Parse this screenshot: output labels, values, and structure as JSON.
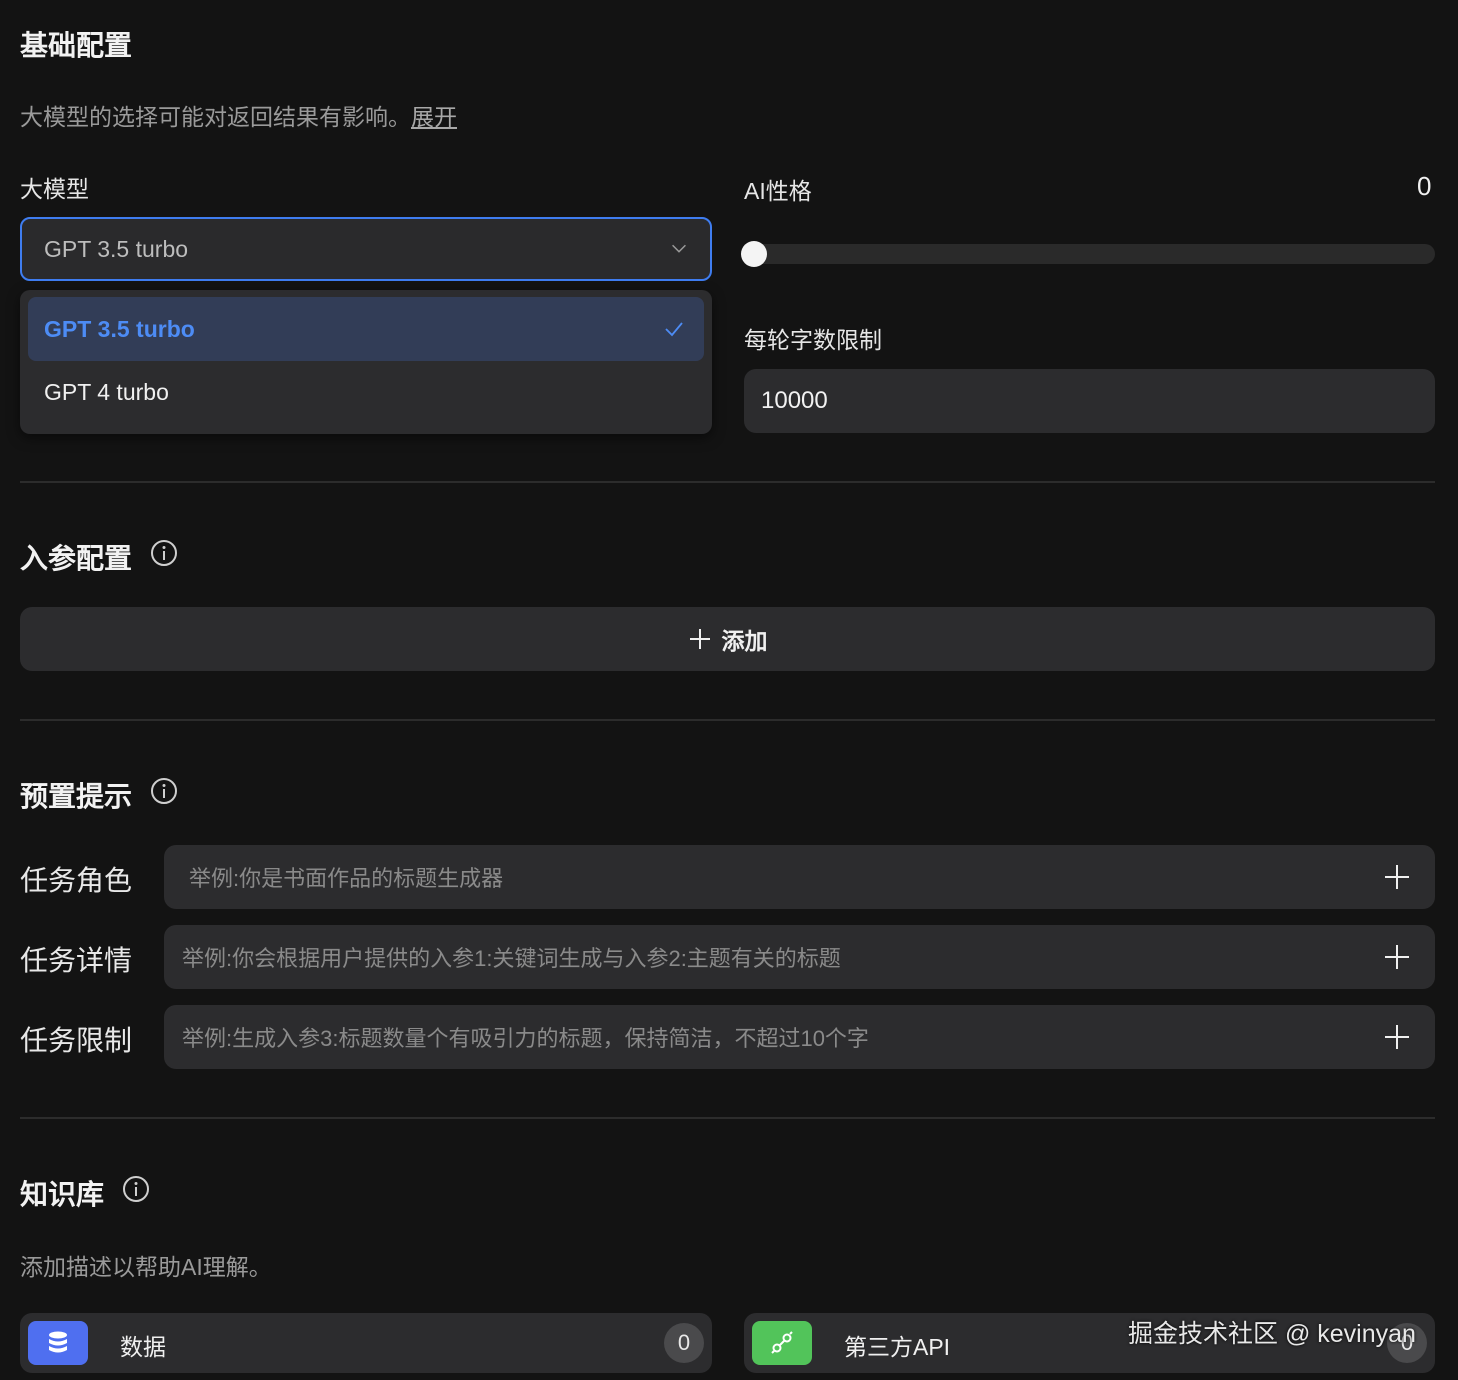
{
  "basic": {
    "title": "基础配置",
    "desc": "大模型的选择可能对返回结果有影响。",
    "expand_link": "展开",
    "model_label": "大模型",
    "model_selected": "GPT 3.5 turbo",
    "model_options": [
      "GPT 3.5 turbo",
      "GPT 4 turbo"
    ],
    "personality_label": "AI性格",
    "personality_value": "0",
    "word_limit_label": "每轮字数限制",
    "word_limit_value": "10000"
  },
  "params": {
    "title": "入参配置",
    "add_label": "添加"
  },
  "preset": {
    "title": "预置提示",
    "rows": [
      {
        "label": "任务角色",
        "placeholder": "举例:你是书面作品的标题生成器"
      },
      {
        "label": "任务详情",
        "placeholder": "举例:你会根据用户提供的入参1:关键词生成与入参2:主题有关的标题"
      },
      {
        "label": "任务限制",
        "placeholder": "举例:生成入参3:标题数量个有吸引力的标题，保持简洁，不超过10个字"
      }
    ]
  },
  "knowledge": {
    "title": "知识库",
    "desc": "添加描述以帮助AI理解。",
    "cards": [
      {
        "label": "数据",
        "count": "0",
        "icon": "database-icon",
        "color": "#4f6ff0"
      },
      {
        "label": "第三方API",
        "count": "0",
        "icon": "link-icon",
        "color": "#52c45a"
      }
    ]
  },
  "watermark": "掘金技术社区 @ kevinyan",
  "colors": {
    "accent": "#3f7df0",
    "background": "#131313",
    "card": "#2c2c2e"
  }
}
